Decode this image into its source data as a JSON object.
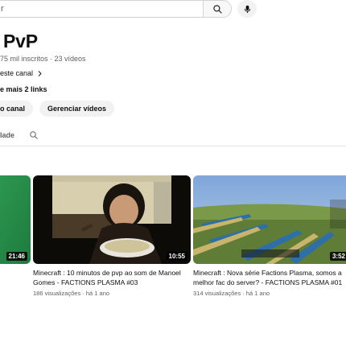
{
  "search": {
    "placeholder": "r"
  },
  "channel": {
    "name": "PvP",
    "meta": "75 mil inscritos · 23 vídeos",
    "about": "este canal",
    "links": "e mais 2 links"
  },
  "buttons": {
    "customize": "o canal",
    "manage": "Gerenciar vídeos"
  },
  "tabs": {
    "community": "lade"
  },
  "videos": [
    {
      "duration": "21:46",
      "title": "",
      "meta": ""
    },
    {
      "duration": "10:55",
      "title": "Minecraft : 10 minutos de pvp ao som de Manoel Gomes - FACTIONS PLASMA #03",
      "meta": "186 visualizações · há 1 ano"
    },
    {
      "duration": "3:52",
      "title": "Minecraft : Nova série Factions Plasma, somos a melhor fac do server? - FACTIONS PLASMA #01",
      "meta": "314 visualizações · há 1 ano"
    }
  ],
  "colors": {
    "text": "#0f0f0f",
    "muted": "#606060",
    "pill": "#f2f2f2"
  }
}
